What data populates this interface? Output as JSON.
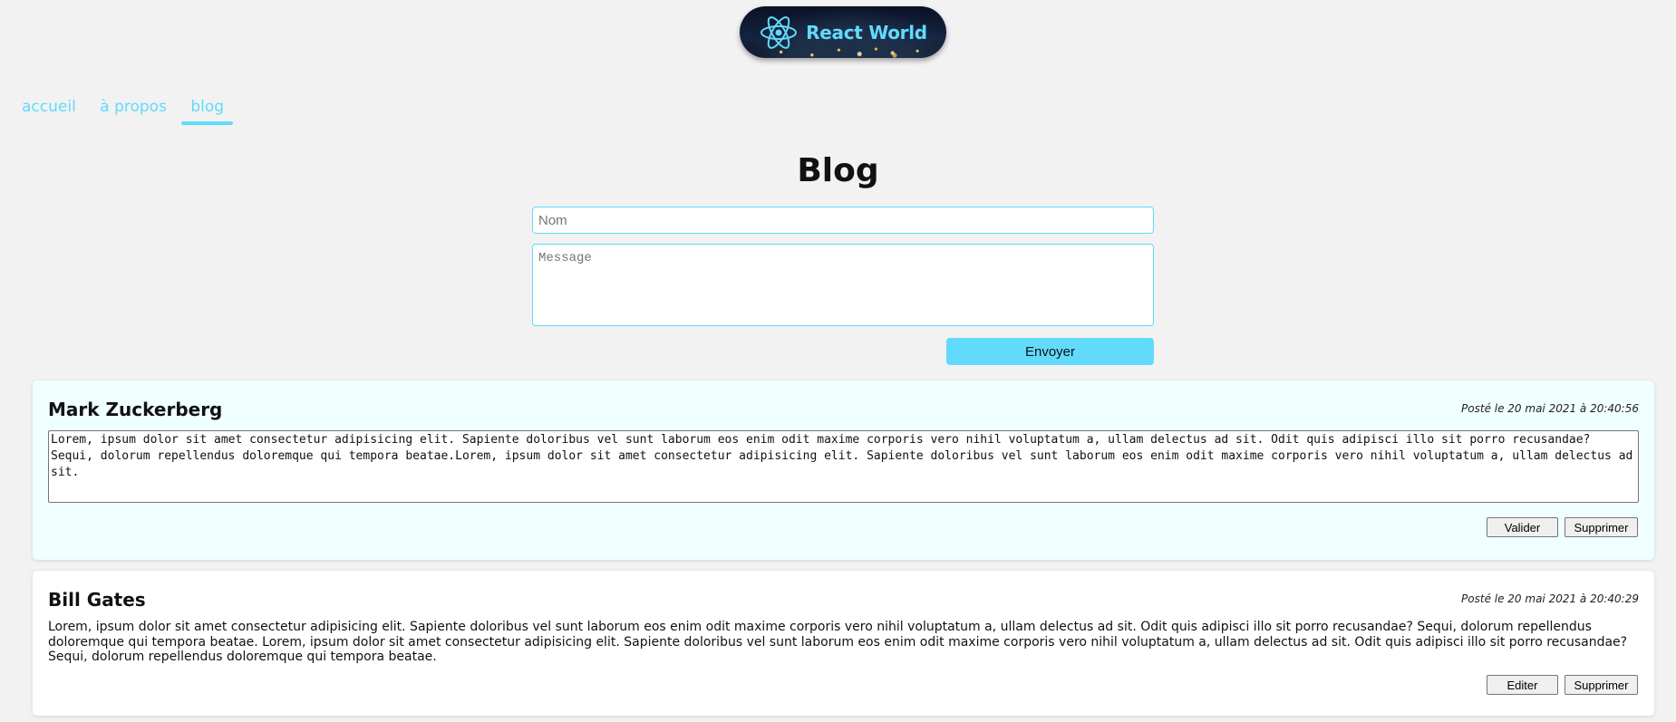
{
  "logo": {
    "text": "React World"
  },
  "nav": {
    "items": [
      {
        "label": "accueil"
      },
      {
        "label": "à propos"
      },
      {
        "label": "blog"
      }
    ],
    "active": "blog"
  },
  "page_title": "Blog",
  "form": {
    "name_placeholder": "Nom",
    "message_placeholder": "Message",
    "send_label": "Envoyer"
  },
  "posts": [
    {
      "author": "Mark Zuckerberg",
      "date": "Posté le 20 mai 2021 à 20:40:56",
      "text": "Lorem, ipsum dolor sit amet consectetur adipisicing elit. Sapiente doloribus vel sunt laborum eos enim odit maxime corporis vero nihil voluptatum a, ullam delectus ad sit. Odit quis adipisci illo sit porro recusandae? Sequi, dolorum repellendus doloremque qui tempora beatae.Lorem, ipsum dolor sit amet consectetur adipisicing elit. Sapiente doloribus vel sunt laborum eos enim odit maxime corporis vero nihil voluptatum a, ullam delectus ad sit.",
      "mode": "editing",
      "primary_button": "Valider",
      "delete_button": "Supprimer"
    },
    {
      "author": "Bill Gates",
      "date": "Posté le 20 mai 2021 à 20:40:29",
      "text": "Lorem, ipsum dolor sit amet consectetur adipisicing elit. Sapiente doloribus vel sunt laborum eos enim odit maxime corporis vero nihil voluptatum a, ullam delectus ad sit. Odit quis adipisci illo sit porro recusandae? Sequi, dolorum repellendus doloremque qui tempora beatae. Lorem, ipsum dolor sit amet consectetur adipisicing elit. Sapiente doloribus vel sunt laborum eos enim odit maxime corporis vero nihil voluptatum a, ullam delectus ad sit. Odit quis adipisci illo sit porro recusandae? Sequi, dolorum repellendus doloremque qui tempora beatae.",
      "mode": "view",
      "primary_button": "Editer",
      "delete_button": "Supprimer"
    }
  ],
  "colors": {
    "accent": "#61dafb",
    "background": "#f2f2f2",
    "editing_card": "#f0ffff"
  },
  "icons": {
    "logo_icon": "react-atom-icon"
  }
}
